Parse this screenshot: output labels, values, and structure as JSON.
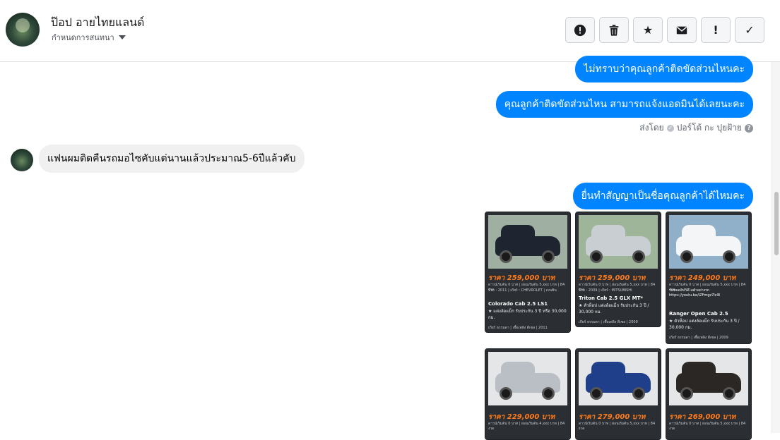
{
  "header": {
    "name": "ป๊อป อายไทยแลนด์",
    "subtitle": "กำหนดการสนทนา",
    "tools": [
      {
        "icon": "alert-circle-icon",
        "glyph": "!"
      },
      {
        "icon": "trash-icon",
        "glyph": ""
      },
      {
        "icon": "star-icon",
        "glyph": "★"
      },
      {
        "icon": "envelope-icon",
        "glyph": "✉"
      },
      {
        "icon": "exclamation-icon",
        "glyph": "!"
      },
      {
        "icon": "checkmark-icon",
        "glyph": "✓"
      }
    ]
  },
  "messages": {
    "out1": "ไม่ทราบว่าคุณลูกค้าติดขัดส่วนไหนคะ",
    "out2": "คุณลูกค้าติดขัดส่วนไหน สามารถแจ้งแอดมินได้เลยนะคะ",
    "sent_by_prefix": "ส่งโดย",
    "sent_by_name": "ปอร์โต้ กะ ปุยฝ้าย",
    "in1": "แฟนผมติดคืนรถมอไซคับแต่นานแล้วประมาณ5-6ปีแล้วคับ",
    "out3": "ยื่นทำสัญญาเป็นชื่อคุณลูกค้าได้ไหมคะ"
  },
  "cards": [
    {
      "price": "ราคา 259,000 บาท",
      "fine1": "ดาวน์เริ่มต้น 0 บาท | ผ่อนเริ่มต้น 5,xxx บาท | 84 งวด",
      "fine2": "ปีรถ : 2011 | เกียร์ : CHEVROLET | เบนซิน",
      "model": "Colorado Cab 2.5 LS1",
      "desc": "★ แต่งล้อแม็ก รับประกัน 3 ปี หรือ 30,000 กม.",
      "foot": "เกียร์ ธรรมดา | เชื้อเพลิง ดีเซล | 2011",
      "body": "#1e2530",
      "bg": "#9fb0a2"
    },
    {
      "price": "ราคา 259,000 บาท",
      "fine1": "ดาวน์เริ่มต้น 0 บาท | ผ่อนเริ่มต้น 5,xxx บาท | 84 งวด",
      "fine2": "ปีรถ : 2009 | เกียร์ : MITSUBISHI",
      "model": "Triton Cab 2.5 GLX MT*",
      "desc": "★ ตัวท็อป แต่งล้อแม็ก รับประกัน 3 ปี / 30,000 กม.",
      "foot": "เกียร์ ธรรมดา | เชื้อเพลิง ดีเซล | 2009",
      "body": "#c9ced3",
      "bg": "#9fb59a"
    },
    {
      "price": "ราคา 249,000 บาท",
      "fine1": "ดาวน์เริ่มต้น 0 บาท | ผ่อนเริ่มต้น 5,xxx บาท | 84 งวด",
      "fine2": "รับชมคลิปวิดีโอตัวอย่างรถ https://youtu.be/iZFmgz7lcl8",
      "model": "Ranger Open Cab 2.5",
      "desc": "★ ตัวท็อป แต่งล้อแม็ก รับประกัน 3 ปี / 30,000 กม.",
      "foot": "เกียร์ ธรรมดา | เชื้อเพลิง ดีเซล | 2009",
      "body": "#f4f5f6",
      "bg": "#8fb0c8"
    },
    {
      "price": "ราคา 229,000 บาท",
      "fine1": "ดาวน์เริ่มต้น 0 บาท | ผ่อนเริ่มต้น 4,xxx บาท | 84 งวด",
      "model": "",
      "desc": "",
      "foot": "",
      "body": "#b9bfc5",
      "bg": "#e4e6e8"
    },
    {
      "price": "ราคา 279,000 บาท",
      "fine1": "ดาวน์เริ่มต้น 0 บาท | ผ่อนเริ่มต้น 5,xxx บาท | 84 งวด",
      "model": "",
      "desc": "",
      "foot": "",
      "body": "#1f3f8a",
      "bg": "#e4e6e8"
    },
    {
      "price": "ราคา 269,000 บาท",
      "fine1": "ดาวน์เริ่มต้น 0 บาท | ผ่อนเริ่มต้น 5,xxx บาท | 84 งวด",
      "model": "",
      "desc": "",
      "foot": "",
      "body": "#2a2724",
      "bg": "#e4e6e8"
    }
  ]
}
